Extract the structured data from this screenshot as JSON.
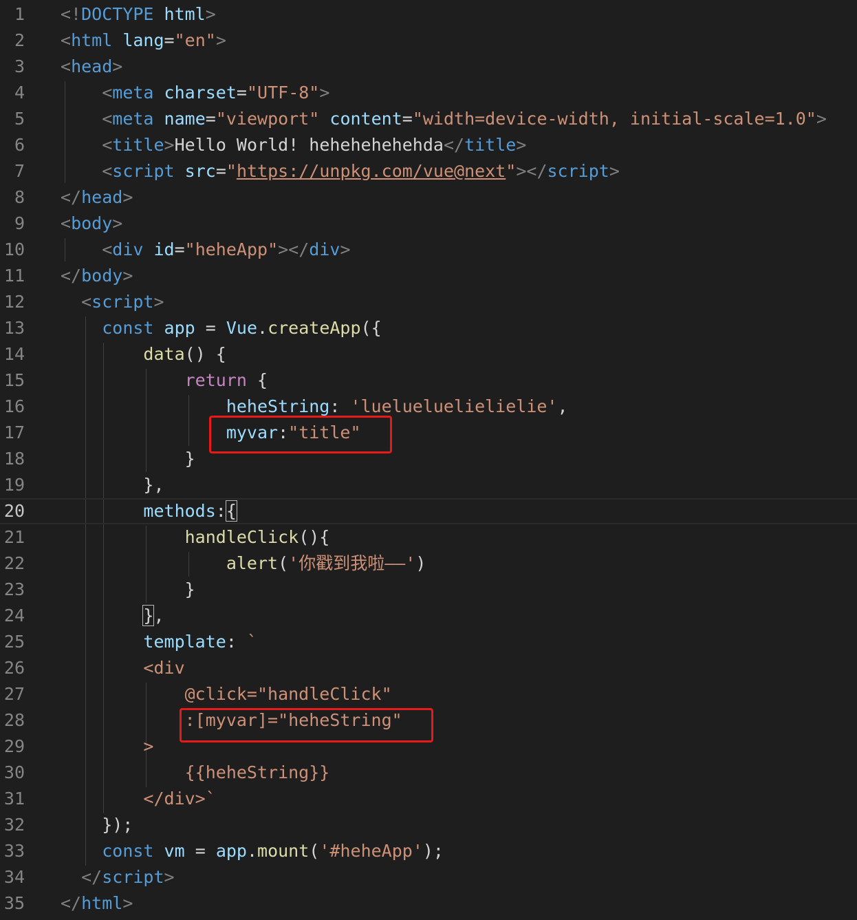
{
  "editor": {
    "current_line": 20,
    "lines": [
      {
        "n": "1",
        "tokens": [
          {
            "t": "<!",
            "c": "punc"
          },
          {
            "t": "DOCTYPE",
            "c": "tag"
          },
          {
            "t": " html",
            "c": "attr"
          },
          {
            "t": ">",
            "c": "punc"
          }
        ]
      },
      {
        "n": "2",
        "tokens": [
          {
            "t": "<",
            "c": "punc"
          },
          {
            "t": "html",
            "c": "tag"
          },
          {
            "t": " lang",
            "c": "attr"
          },
          {
            "t": "=",
            "c": "text"
          },
          {
            "t": "\"en\"",
            "c": "str"
          },
          {
            "t": ">",
            "c": "punc"
          }
        ]
      },
      {
        "n": "3",
        "tokens": [
          {
            "t": "<",
            "c": "punc"
          },
          {
            "t": "head",
            "c": "tag"
          },
          {
            "t": ">",
            "c": "punc"
          }
        ]
      },
      {
        "n": "4",
        "tokens": [
          {
            "t": "    ",
            "c": "text"
          },
          {
            "t": "<",
            "c": "punc"
          },
          {
            "t": "meta",
            "c": "tag"
          },
          {
            "t": " charset",
            "c": "attr"
          },
          {
            "t": "=",
            "c": "text"
          },
          {
            "t": "\"UTF-8\"",
            "c": "str"
          },
          {
            "t": ">",
            "c": "punc"
          }
        ]
      },
      {
        "n": "5",
        "tokens": [
          {
            "t": "    ",
            "c": "text"
          },
          {
            "t": "<",
            "c": "punc"
          },
          {
            "t": "meta",
            "c": "tag"
          },
          {
            "t": " name",
            "c": "attr"
          },
          {
            "t": "=",
            "c": "text"
          },
          {
            "t": "\"viewport\"",
            "c": "str"
          },
          {
            "t": " content",
            "c": "attr"
          },
          {
            "t": "=",
            "c": "text"
          },
          {
            "t": "\"width=device-width, initial-scale=1.0\"",
            "c": "str"
          },
          {
            "t": ">",
            "c": "punc"
          }
        ]
      },
      {
        "n": "6",
        "tokens": [
          {
            "t": "    ",
            "c": "text"
          },
          {
            "t": "<",
            "c": "punc"
          },
          {
            "t": "title",
            "c": "tag"
          },
          {
            "t": ">",
            "c": "punc"
          },
          {
            "t": "Hello World! hehehehehehda",
            "c": "text"
          },
          {
            "t": "</",
            "c": "punc"
          },
          {
            "t": "title",
            "c": "tag"
          },
          {
            "t": ">",
            "c": "punc"
          }
        ]
      },
      {
        "n": "7",
        "tokens": [
          {
            "t": "    ",
            "c": "text"
          },
          {
            "t": "<",
            "c": "punc"
          },
          {
            "t": "script",
            "c": "tag"
          },
          {
            "t": " src",
            "c": "attr"
          },
          {
            "t": "=",
            "c": "text"
          },
          {
            "t": "\"",
            "c": "str"
          },
          {
            "t": "https://unpkg.com/vue@next",
            "c": "link"
          },
          {
            "t": "\"",
            "c": "str"
          },
          {
            "t": "></",
            "c": "punc"
          },
          {
            "t": "script",
            "c": "tag"
          },
          {
            "t": ">",
            "c": "punc"
          }
        ]
      },
      {
        "n": "8",
        "tokens": [
          {
            "t": "</",
            "c": "punc"
          },
          {
            "t": "head",
            "c": "tag"
          },
          {
            "t": ">",
            "c": "punc"
          }
        ]
      },
      {
        "n": "9",
        "tokens": [
          {
            "t": "<",
            "c": "punc"
          },
          {
            "t": "body",
            "c": "tag"
          },
          {
            "t": ">",
            "c": "punc"
          }
        ]
      },
      {
        "n": "10",
        "tokens": [
          {
            "t": "    ",
            "c": "text"
          },
          {
            "t": "<",
            "c": "punc"
          },
          {
            "t": "div",
            "c": "tag"
          },
          {
            "t": " id",
            "c": "attr"
          },
          {
            "t": "=",
            "c": "text"
          },
          {
            "t": "\"heheApp\"",
            "c": "str"
          },
          {
            "t": "></",
            "c": "punc"
          },
          {
            "t": "div",
            "c": "tag"
          },
          {
            "t": ">",
            "c": "punc"
          }
        ]
      },
      {
        "n": "11",
        "tokens": [
          {
            "t": "</",
            "c": "punc"
          },
          {
            "t": "body",
            "c": "tag"
          },
          {
            "t": ">",
            "c": "punc"
          }
        ]
      },
      {
        "n": "12",
        "tokens": [
          {
            "t": "  ",
            "c": "text"
          },
          {
            "t": "<",
            "c": "punc"
          },
          {
            "t": "script",
            "c": "tag"
          },
          {
            "t": ">",
            "c": "punc"
          }
        ]
      },
      {
        "n": "13",
        "tokens": [
          {
            "t": "    ",
            "c": "text"
          },
          {
            "t": "const",
            "c": "kw"
          },
          {
            "t": " ",
            "c": "text"
          },
          {
            "t": "app",
            "c": "var"
          },
          {
            "t": " = ",
            "c": "text"
          },
          {
            "t": "Vue",
            "c": "var"
          },
          {
            "t": ".",
            "c": "text"
          },
          {
            "t": "createApp",
            "c": "fn"
          },
          {
            "t": "({",
            "c": "text"
          }
        ]
      },
      {
        "n": "14",
        "tokens": [
          {
            "t": "        ",
            "c": "text"
          },
          {
            "t": "data",
            "c": "fn"
          },
          {
            "t": "() {",
            "c": "text"
          }
        ]
      },
      {
        "n": "15",
        "tokens": [
          {
            "t": "            ",
            "c": "text"
          },
          {
            "t": "return",
            "c": "ctrl"
          },
          {
            "t": " {",
            "c": "text"
          }
        ]
      },
      {
        "n": "16",
        "tokens": [
          {
            "t": "                ",
            "c": "text"
          },
          {
            "t": "heheString",
            "c": "var"
          },
          {
            "t": ": ",
            "c": "text"
          },
          {
            "t": "'luelueluelielielie'",
            "c": "str"
          },
          {
            "t": ",",
            "c": "text"
          }
        ]
      },
      {
        "n": "17",
        "tokens": [
          {
            "t": "                ",
            "c": "text"
          },
          {
            "t": "myvar",
            "c": "var"
          },
          {
            "t": ":",
            "c": "text"
          },
          {
            "t": "\"title\"",
            "c": "str"
          }
        ]
      },
      {
        "n": "18",
        "tokens": [
          {
            "t": "            }",
            "c": "text"
          }
        ]
      },
      {
        "n": "19",
        "tokens": [
          {
            "t": "        },",
            "c": "text"
          }
        ]
      },
      {
        "n": "20",
        "tokens": [
          {
            "t": "        ",
            "c": "text"
          },
          {
            "t": "methods",
            "c": "var"
          },
          {
            "t": ":",
            "c": "text"
          },
          {
            "t": "{",
            "c": "cursor"
          }
        ]
      },
      {
        "n": "21",
        "tokens": [
          {
            "t": "            ",
            "c": "text"
          },
          {
            "t": "handleClick",
            "c": "fn"
          },
          {
            "t": "(){",
            "c": "text"
          }
        ]
      },
      {
        "n": "22",
        "tokens": [
          {
            "t": "                ",
            "c": "text"
          },
          {
            "t": "alert",
            "c": "fn"
          },
          {
            "t": "(",
            "c": "text"
          },
          {
            "t": "'你戳到我啦——'",
            "c": "str"
          },
          {
            "t": ")",
            "c": "text"
          }
        ]
      },
      {
        "n": "23",
        "tokens": [
          {
            "t": "            }",
            "c": "text"
          }
        ]
      },
      {
        "n": "24",
        "tokens": [
          {
            "t": "        ",
            "c": "text"
          },
          {
            "t": "}",
            "c": "cursor"
          },
          {
            "t": ",",
            "c": "text"
          }
        ]
      },
      {
        "n": "25",
        "tokens": [
          {
            "t": "        ",
            "c": "text"
          },
          {
            "t": "template",
            "c": "var"
          },
          {
            "t": ": ",
            "c": "text"
          },
          {
            "t": "`",
            "c": "str"
          }
        ]
      },
      {
        "n": "26",
        "tokens": [
          {
            "t": "        <div",
            "c": "str"
          }
        ]
      },
      {
        "n": "27",
        "tokens": [
          {
            "t": "            @click=\"handleClick\"",
            "c": "str"
          }
        ]
      },
      {
        "n": "28",
        "tokens": [
          {
            "t": "            :[myvar]=\"heheString\"",
            "c": "str"
          }
        ]
      },
      {
        "n": "29",
        "tokens": [
          {
            "t": "        >",
            "c": "str"
          }
        ]
      },
      {
        "n": "30",
        "tokens": [
          {
            "t": "            {{heheString}}",
            "c": "str"
          }
        ]
      },
      {
        "n": "31",
        "tokens": [
          {
            "t": "        </div>`",
            "c": "str"
          }
        ]
      },
      {
        "n": "32",
        "tokens": [
          {
            "t": "    });",
            "c": "text"
          }
        ]
      },
      {
        "n": "33",
        "tokens": [
          {
            "t": "    ",
            "c": "text"
          },
          {
            "t": "const",
            "c": "kw"
          },
          {
            "t": " ",
            "c": "text"
          },
          {
            "t": "vm",
            "c": "var"
          },
          {
            "t": " = ",
            "c": "text"
          },
          {
            "t": "app",
            "c": "var"
          },
          {
            "t": ".",
            "c": "text"
          },
          {
            "t": "mount",
            "c": "fn"
          },
          {
            "t": "(",
            "c": "text"
          },
          {
            "t": "'#heheApp'",
            "c": "str"
          },
          {
            "t": ");",
            "c": "text"
          }
        ]
      },
      {
        "n": "34",
        "tokens": [
          {
            "t": "  ",
            "c": "text"
          },
          {
            "t": "</",
            "c": "punc"
          },
          {
            "t": "script",
            "c": "tag"
          },
          {
            "t": ">",
            "c": "punc"
          }
        ]
      },
      {
        "n": "35",
        "tokens": [
          {
            "t": "</",
            "c": "punc"
          },
          {
            "t": "html",
            "c": "tag"
          },
          {
            "t": ">",
            "c": "punc"
          }
        ]
      }
    ]
  },
  "annotations": {
    "highlight_color": "#e81919",
    "highlighted_lines": [
      17,
      28
    ]
  }
}
